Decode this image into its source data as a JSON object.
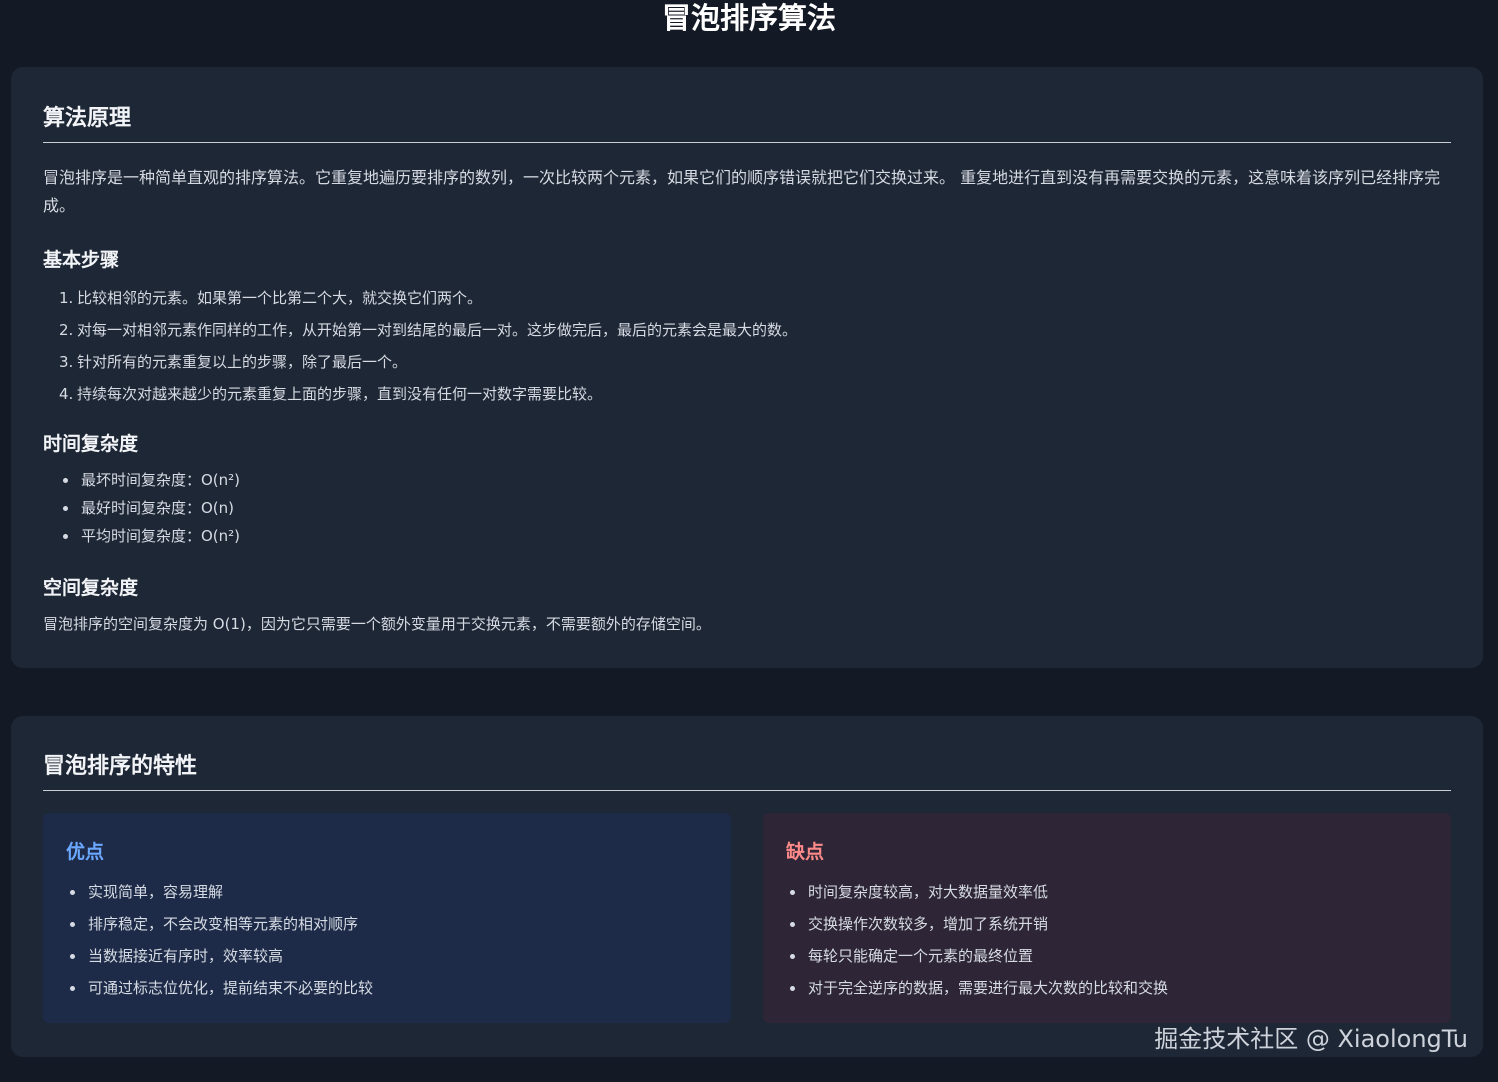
{
  "page": {
    "title": "冒泡排序算法"
  },
  "principle": {
    "heading": "算法原理",
    "intro": "冒泡排序是一种简单直观的排序算法。它重复地遍历要排序的数列，一次比较两个元素，如果它们的顺序错误就把它们交换过来。 重复地进行直到没有再需要交换的元素，这意味着该序列已经排序完成。",
    "steps_heading": "基本步骤",
    "steps": [
      {
        "num": "1.",
        "text": "比较相邻的元素。如果第一个比第二个大，就交换它们两个。"
      },
      {
        "num": "2.",
        "text": "对每一对相邻元素作同样的工作，从开始第一对到结尾的最后一对。这步做完后，最后的元素会是最大的数。"
      },
      {
        "num": "3.",
        "text": "针对所有的元素重复以上的步骤，除了最后一个。"
      },
      {
        "num": "4.",
        "text": "持续每次对越来越少的元素重复上面的步骤，直到没有任何一对数字需要比较。"
      }
    ],
    "time_heading": "时间复杂度",
    "time_items": [
      "最坏时间复杂度：O(n²)",
      "最好时间复杂度：O(n)",
      "平均时间复杂度：O(n²)"
    ],
    "space_heading": "空间复杂度",
    "space_text": "冒泡排序的空间复杂度为 O(1)，因为它只需要一个额外变量用于交换元素，不需要额外的存储空间。"
  },
  "traits": {
    "heading": "冒泡排序的特性",
    "pros": {
      "title": "优点",
      "color": "#6ba8ff",
      "items": [
        "实现简单，容易理解",
        "排序稳定，不会改变相等元素的相对顺序",
        "当数据接近有序时，效率较高",
        "可通过标志位优化，提前结束不必要的比较"
      ]
    },
    "cons": {
      "title": "缺点",
      "color": "#ff8a8a",
      "items": [
        "时间复杂度较高，对大数据量效率低",
        "交换操作次数较多，增加了系统开销",
        "每轮只能确定一个元素的最终位置",
        "对于完全逆序的数据，需要进行最大次数的比较和交换"
      ]
    }
  },
  "watermark": "掘金技术社区 @ XiaolongTu"
}
